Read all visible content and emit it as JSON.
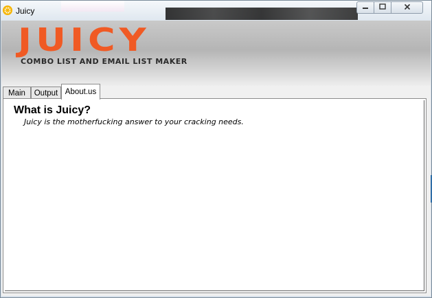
{
  "window": {
    "title": "Juicy",
    "icon": "juicy-sun-icon",
    "controls": {
      "minimize": "minimize-icon",
      "maximize": "maximize-icon",
      "close": "close-icon"
    }
  },
  "banner": {
    "logo_text": "JUICY",
    "tagline": "COMBO LIST AND EMAIL LIST MAKER",
    "logo_color": "#f05a24"
  },
  "tabs": [
    {
      "label": "Main",
      "active": false
    },
    {
      "label": "Output",
      "active": false
    },
    {
      "label": "About.us",
      "active": true
    }
  ],
  "about": {
    "heading": "What is Juicy?",
    "text": "Juicy is the motherfucking answer to your cracking needs."
  }
}
